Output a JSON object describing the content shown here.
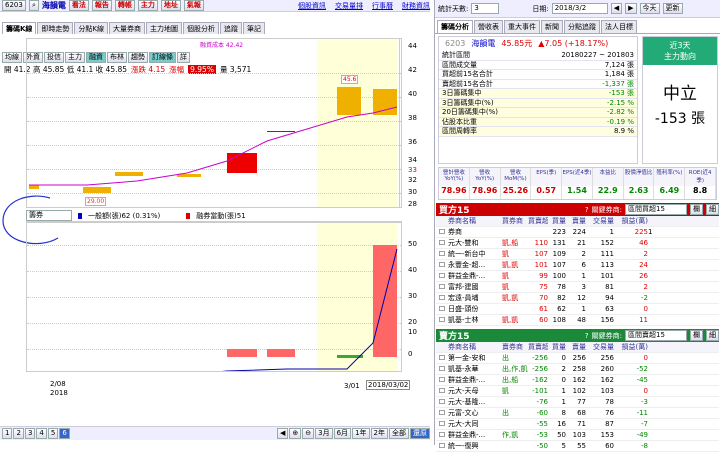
{
  "topbar": {
    "stock_code": "6203",
    "stock_name": "海韻電",
    "buttons": [
      "看法",
      "報告",
      "轉帳",
      "主力",
      "地址",
      "氣報"
    ],
    "links": [
      "個股資訊",
      "交易量排",
      "行事曆",
      "財務資訊"
    ]
  },
  "tabs1": [
    "籌碼K線",
    "即時走勢",
    "分點K線",
    "大量券商",
    "主力地圖",
    "個股分析",
    "追蹤",
    "筆記"
  ],
  "tabs2": [
    "均線",
    "外資",
    "投信",
    "主力",
    "融資",
    "布林",
    "趨勢",
    "訂線條",
    "詳"
  ],
  "price_legend": "開 41.2 高 45.85 低 41.1 收 45.85",
  "price_change": "漲跌 4.15",
  "pct_label": "漲幅",
  "pct_value": "9.95%",
  "vol_label": "量 3,571",
  "ma_label": "融資成本 42.42",
  "bar_label_top": "45.6",
  "low_label": "29.00",
  "price_ticks": [
    "44",
    "42",
    "40",
    "38",
    "36",
    "34",
    "33",
    "32",
    "30",
    "28"
  ],
  "panel2": {
    "select": "籌券",
    "legend1": "一般額(張)62 (0.31%)",
    "legend2": "融券當動(張)51"
  },
  "vol_ticks": [
    "50",
    "40",
    "30",
    "20",
    "10",
    "0"
  ],
  "x_labels": {
    "start": "2/08",
    "start_year": "2018",
    "mid": "3/01",
    "end": "2018/03/02"
  },
  "bottom": {
    "pages": [
      "1",
      "2",
      "3",
      "4",
      "5",
      "6"
    ],
    "ranges": [
      "3月",
      "6月",
      "1年",
      "2年",
      "全部",
      "還原"
    ]
  },
  "right_top": {
    "period_label": "統計天數:",
    "period_value": "3",
    "date_label": "日期:",
    "date_value": "2018/3/2",
    "btn1": "今天",
    "btn2": "更新"
  },
  "right_tabs": [
    "籌碼分析",
    "營收表",
    "重大事件",
    "新聞",
    "分點追蹤",
    "法人目標"
  ],
  "quote": {
    "code": "6203",
    "name": "海韻電",
    "price": "45.85元",
    "change": "▲7.05 (+18.17%)"
  },
  "stats": [
    {
      "k": "統計區間",
      "v": "20180227 ~ 201803"
    },
    {
      "k": "區間成交量",
      "v": "7,124 張"
    },
    {
      "k": "買超前15名合計",
      "v": "1,184 張"
    },
    {
      "k": "賣超前15名合計",
      "v": "-1,337 張"
    },
    {
      "k": "3日籌碼集中",
      "v": "-153 張"
    },
    {
      "k": "3日籌碼集中(%)",
      "v": "-2.15 %"
    },
    {
      "k": "20日籌碼集中(%)",
      "v": "-2.82 %"
    },
    {
      "k": "佔股本比重",
      "v": "-0.19 %"
    },
    {
      "k": "區間周轉率",
      "v": "8.9 %"
    }
  ],
  "mainforce": {
    "title": "近3天",
    "subtitle": "主力動向",
    "verdict": "中立",
    "amount": "-153 張"
  },
  "fin": {
    "headers": [
      "營計營收YoY(%)",
      "營收YoY(%)",
      "營收MoM(%)",
      "EPS(季)",
      "EPS(近4季)",
      "本益比",
      "股價淨值比",
      "殖利率(%)",
      "ROE(近4季)"
    ],
    "values": [
      "78.96",
      "78.96",
      "25.26",
      "0.57",
      "1.54",
      "22.9",
      "2.63",
      "6.49",
      "8.8"
    ]
  },
  "buy": {
    "title": "買方15",
    "filter_label": "關鍵券商:",
    "filter_value": "區間買超15",
    "btn1": "欄",
    "btn2": "細",
    "headers": [
      "券商名稱",
      "買券商",
      "買賣超",
      "買量",
      "賣量",
      "交易量",
      "損益(萬)"
    ],
    "rows": [
      [
        "券商",
        "",
        "",
        " 223",
        "224",
        "1",
        "225",
        "1"
      ],
      [
        "元大-雙和",
        "凱,船",
        "110",
        "131",
        "21",
        "152",
        "46"
      ],
      [
        "統一-新台中",
        "凱",
        "107",
        "109",
        "2",
        "111",
        "2"
      ],
      [
        "永豐金-超...",
        "凱,凱",
        "101",
        "107",
        "6",
        "113",
        "24"
      ],
      [
        "群益金鼎-...",
        "凱",
        "99",
        "100",
        "1",
        "101",
        "26"
      ],
      [
        "富邦-建國",
        "凱",
        "75",
        "78",
        "3",
        "81",
        "2"
      ],
      [
        "宏遠-員埔",
        "凱,凱",
        "70",
        "82",
        "12",
        "94",
        "-2"
      ],
      [
        "日盛-頭份",
        "",
        "61",
        "62",
        "1",
        "63",
        "0"
      ],
      [
        "凱基-士林",
        "凱,凱",
        "60",
        "108",
        "48",
        "156",
        "11"
      ]
    ]
  },
  "sell": {
    "title": "賣方15",
    "filter_label": "關鍵券商:",
    "filter_value": "區間賣超15",
    "btn1": "欄",
    "btn2": "細",
    "headers": [
      "券商名稱",
      "賣券商",
      "買賣超",
      "買量",
      "賣量",
      "交易量",
      "損益(萬)"
    ],
    "rows": [
      [
        "第一金-安和",
        "出",
        "-256",
        "0",
        "256",
        "256",
        "0"
      ],
      [
        "凱基-永華",
        "出,作,凱",
        "-256",
        "2",
        "258",
        "260",
        "-52"
      ],
      [
        "群益金鼎-...",
        "出,船",
        "-162",
        "0",
        "162",
        "162",
        "-45"
      ],
      [
        "元大-天母",
        "凱",
        "-101",
        "1",
        "102",
        "103",
        "0"
      ],
      [
        "元大-基隆...",
        "",
        "-76",
        "1",
        "77",
        "78",
        "-3"
      ],
      [
        "元富-文心",
        "出",
        "-60",
        "8",
        "68",
        "76",
        "-11"
      ],
      [
        "元大-大同",
        "",
        "-55",
        "16",
        "71",
        "87",
        "-7"
      ],
      [
        "群益金鼎-...",
        "作,凱",
        "-53",
        "50",
        "103",
        "153",
        "-49"
      ],
      [
        "統一-復興",
        "",
        "-50",
        "5",
        "55",
        "60",
        "-8"
      ]
    ]
  }
}
